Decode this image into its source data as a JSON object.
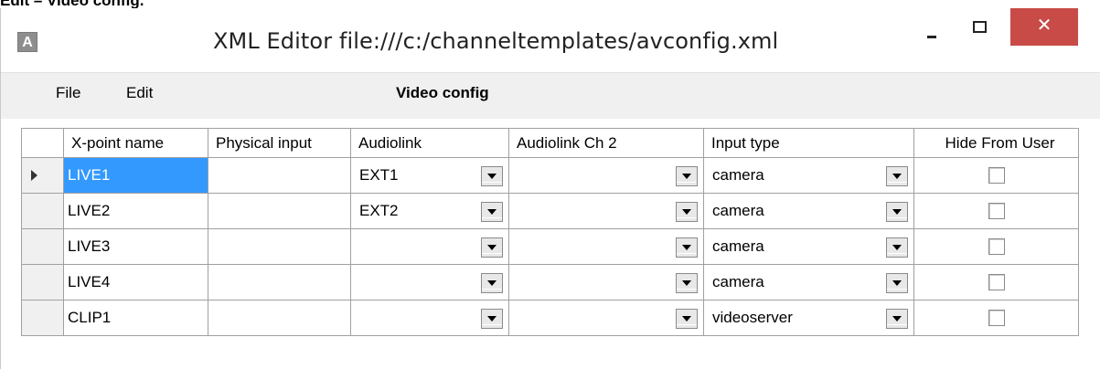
{
  "caption": "Edit – Video config.",
  "window": {
    "title": "XML Editor file:///c:/channeltemplates/avconfig.xml",
    "app_icon_letter": "A",
    "close_glyph": "✕"
  },
  "menu": {
    "file_label": "File",
    "edit_label": "Edit",
    "section_title": "Video config"
  },
  "table": {
    "columns": [
      "X-point name",
      "Physical input",
      "Audiolink",
      "Audiolink Ch 2",
      "Input type",
      "Hide From User"
    ],
    "rows": [
      {
        "name": "LIVE1",
        "physical_input": "",
        "audiolink": "EXT1",
        "audiolink_ch2": "",
        "input_type": "camera",
        "hide": false,
        "current": true
      },
      {
        "name": "LIVE2",
        "physical_input": "",
        "audiolink": "EXT2",
        "audiolink_ch2": "",
        "input_type": "camera",
        "hide": false,
        "current": false
      },
      {
        "name": "LIVE3",
        "physical_input": "",
        "audiolink": "",
        "audiolink_ch2": "",
        "input_type": "camera",
        "hide": false,
        "current": false
      },
      {
        "name": "LIVE4",
        "physical_input": "",
        "audiolink": "",
        "audiolink_ch2": "",
        "input_type": "camera",
        "hide": false,
        "current": false
      },
      {
        "name": "CLIP1",
        "physical_input": "",
        "audiolink": "",
        "audiolink_ch2": "",
        "input_type": "videoserver",
        "hide": false,
        "current": false
      }
    ]
  },
  "colors": {
    "selection": "#3399ff",
    "close_button": "#c84b47",
    "menubar": "#f0f0f0"
  }
}
